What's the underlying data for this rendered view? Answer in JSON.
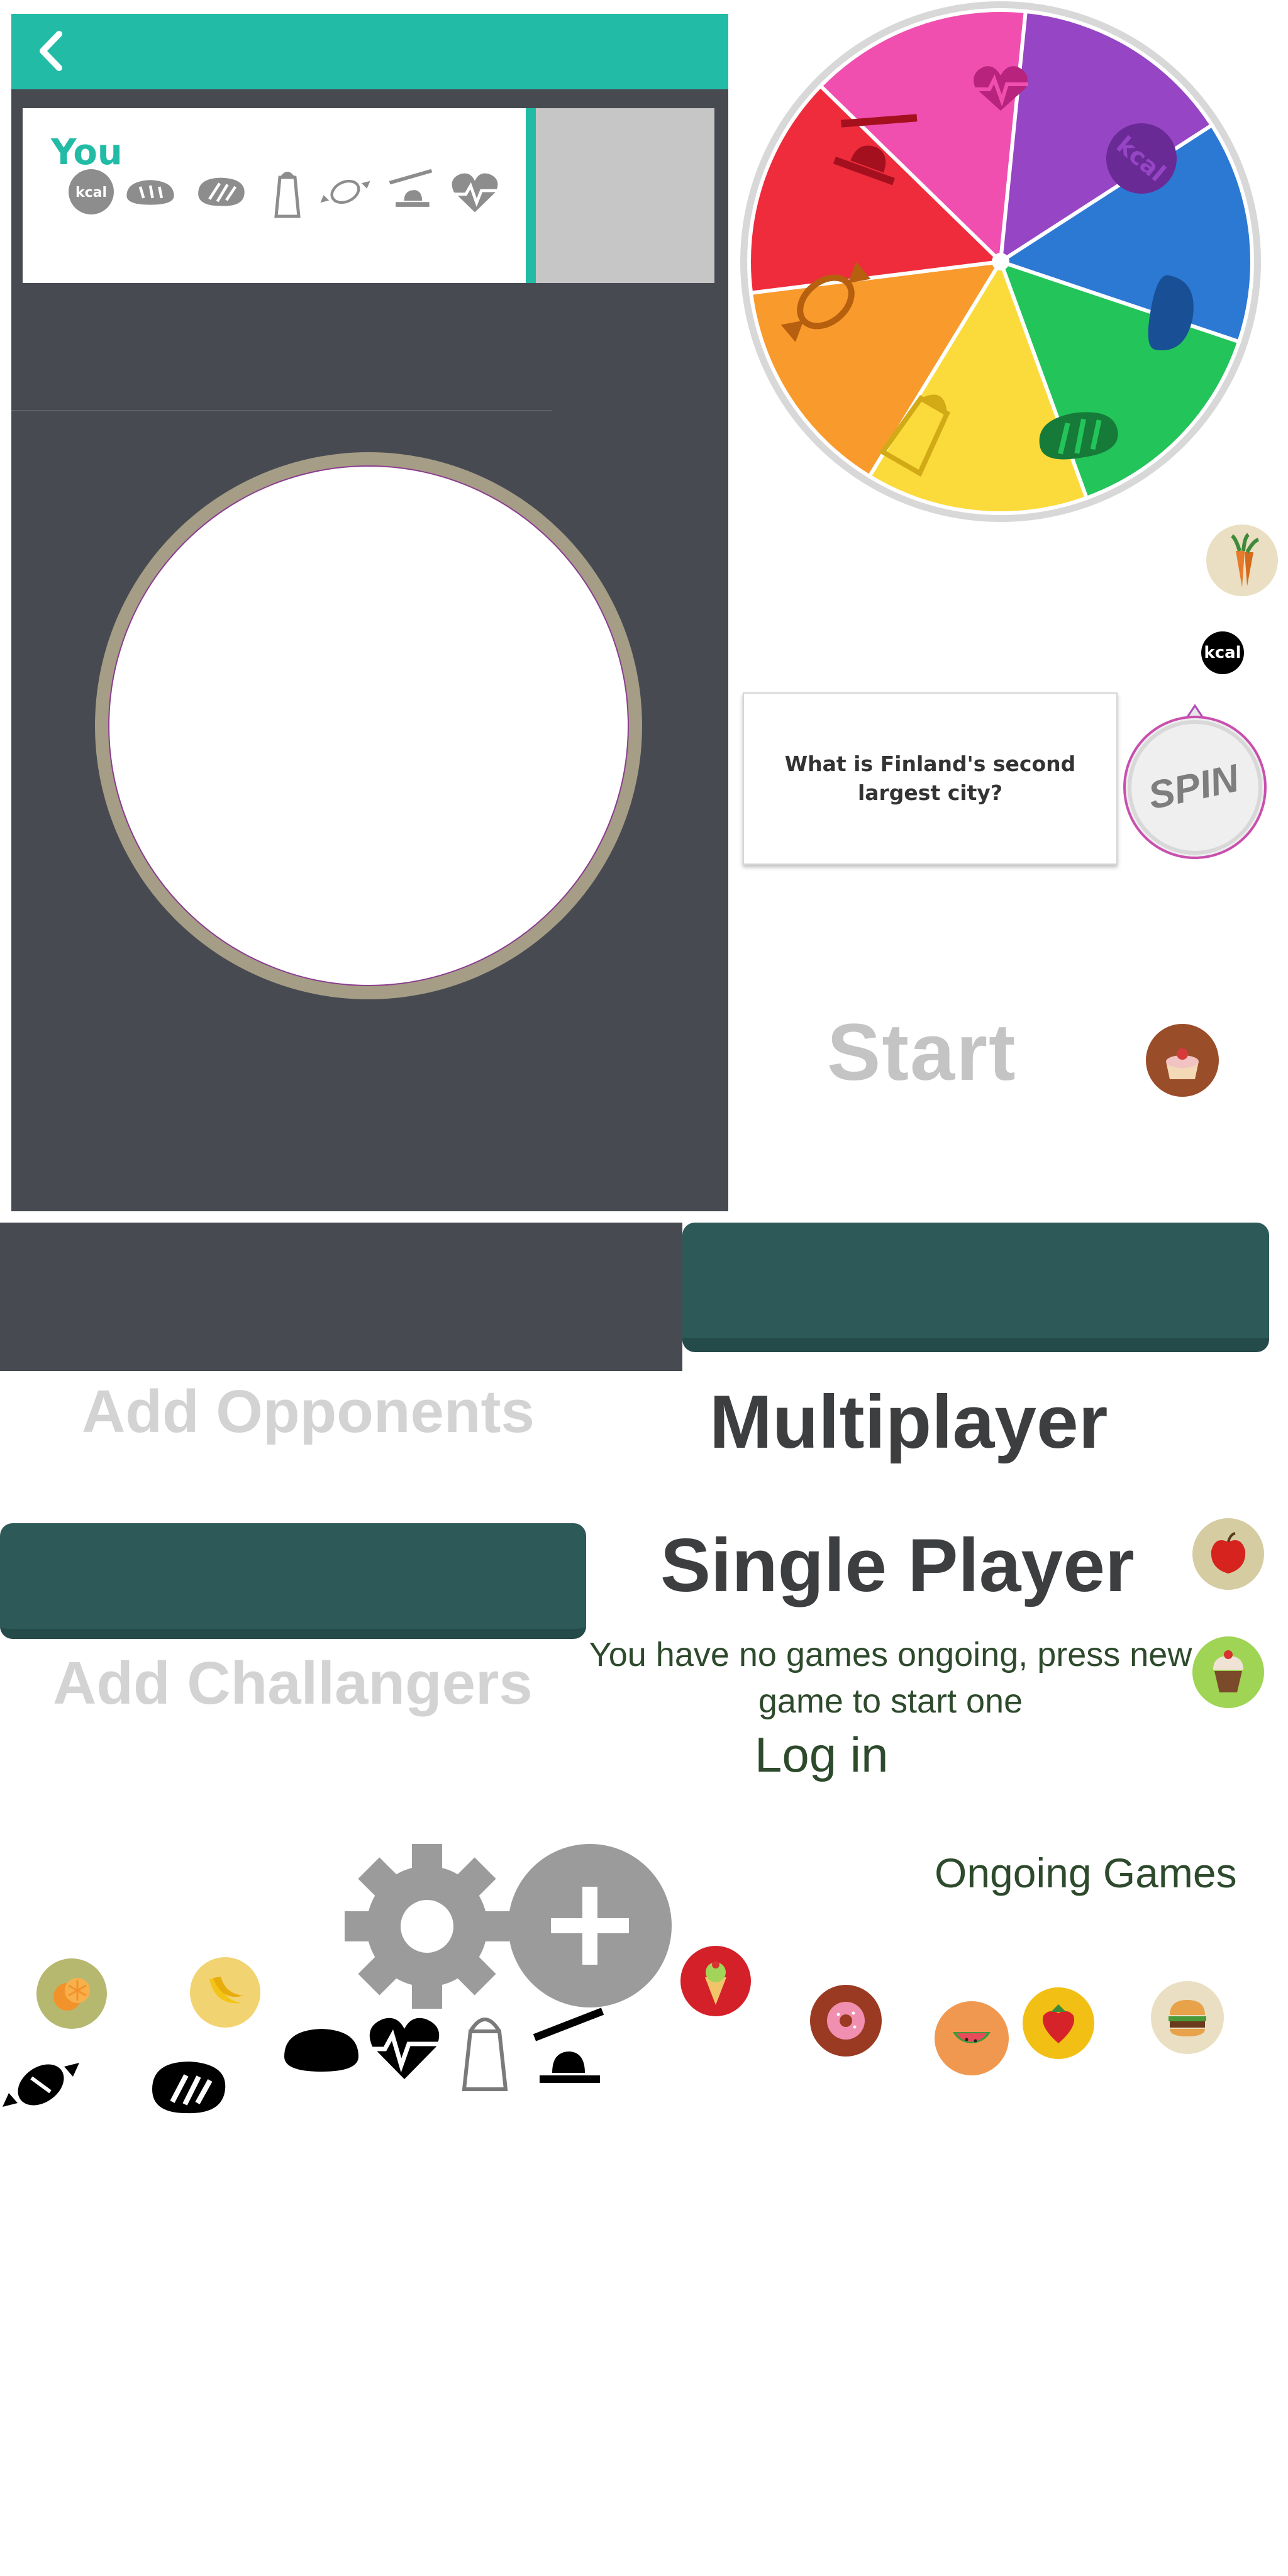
{
  "header": {
    "back_label": "‹"
  },
  "player_card": {
    "name": "You",
    "categories": [
      "kcal-icon",
      "bread-icon",
      "steak-icon",
      "salt-icon",
      "candy-icon",
      "butter-icon",
      "heart-icon"
    ]
  },
  "wheel": {
    "segments": [
      {
        "name": "heart",
        "color": "#f04fb0"
      },
      {
        "name": "kcal",
        "color": "#9645c4"
      },
      {
        "name": "bread",
        "color": "#2c79d4"
      },
      {
        "name": "steak",
        "color": "#23c45a"
      },
      {
        "name": "salt",
        "color": "#fbdb3c"
      },
      {
        "name": "candy",
        "color": "#f99a2c"
      },
      {
        "name": "butter",
        "color": "#ef2c3c"
      }
    ],
    "kcal_label": "kcal"
  },
  "question": {
    "text": "What is Finland's second largest city?"
  },
  "spin": {
    "label": "SPIN"
  },
  "start": {
    "label": "Start"
  },
  "kcal_badge": {
    "label": "kcal"
  },
  "buttons": {
    "add_opponents": "Add Opponents",
    "multiplayer": "Multiplayer",
    "single_player": "Single Player",
    "add_challangers": "Add Challangers"
  },
  "lobby": {
    "no_games": "You have no games ongoing, press new game to start one",
    "login": "Log in",
    "ongoing": "Ongoing Games"
  },
  "food_icons": [
    "carrot-icon",
    "cake-slice-icon",
    "apple-icon",
    "cupcake-icon",
    "orange-icon",
    "banana-icon",
    "ice-cream-icon",
    "donut-icon",
    "watermelon-icon",
    "strawberry-icon",
    "burger-icon"
  ],
  "colors": {
    "teal": "#22bba6",
    "dark_panel": "#474b51",
    "button_green": "#2d5a59",
    "lobby_text": "#2e4a2c"
  }
}
